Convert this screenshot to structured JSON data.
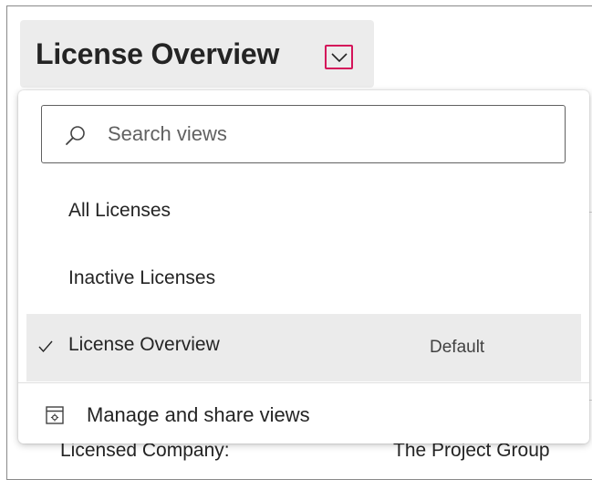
{
  "header": {
    "view_title": "License Overview"
  },
  "background": {
    "field_label": "Licensed Company:",
    "field_value": "The Project Group"
  },
  "dropdown": {
    "search_placeholder": "Search views",
    "items": [
      {
        "label": "All Licenses",
        "selected": false
      },
      {
        "label": "Inactive Licenses",
        "selected": false
      },
      {
        "label": "License Overview",
        "selected": true,
        "badge": "Default"
      }
    ],
    "manage_label": "Manage and share views"
  },
  "colors": {
    "highlight_border": "#d4145a",
    "selected_background": "#ebebeb",
    "switcher_background": "#ececec"
  },
  "icons": {
    "chevron": "chevron-down-icon",
    "search": "search-icon",
    "check": "checkmark-icon",
    "manage": "manage-views-icon"
  }
}
